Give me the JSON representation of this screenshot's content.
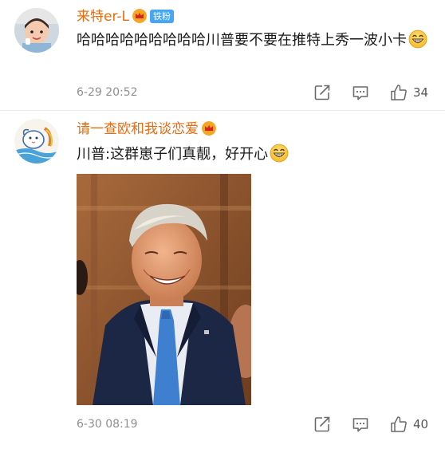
{
  "comments": [
    {
      "username": "来特er-L",
      "badge": "铁粉",
      "text": "哈哈哈哈哈哈哈哈哈川普要不要在推特上秀一波小卡",
      "timestamp": "6-29 20:52",
      "likes": "34",
      "avatar_icon": "baby-avatar",
      "emoji_icon": "grin-emoji"
    },
    {
      "username": "请一查欧和我谈恋爱",
      "text": "川普:这群崽子们真靓，好开心",
      "timestamp": "6-30 08:19",
      "likes": "40",
      "avatar_icon": "illustrated-bird-avatar",
      "emoji_icon": "grin-emoji",
      "image": "smiling-man-photo"
    }
  ],
  "actions": [
    "share-icon",
    "comment-icon",
    "like-icon"
  ],
  "colors": {
    "username": "#e86b0f",
    "badge_bg": "#45a6f5",
    "timestamp": "#909090",
    "icon": "#6a6a6a"
  }
}
